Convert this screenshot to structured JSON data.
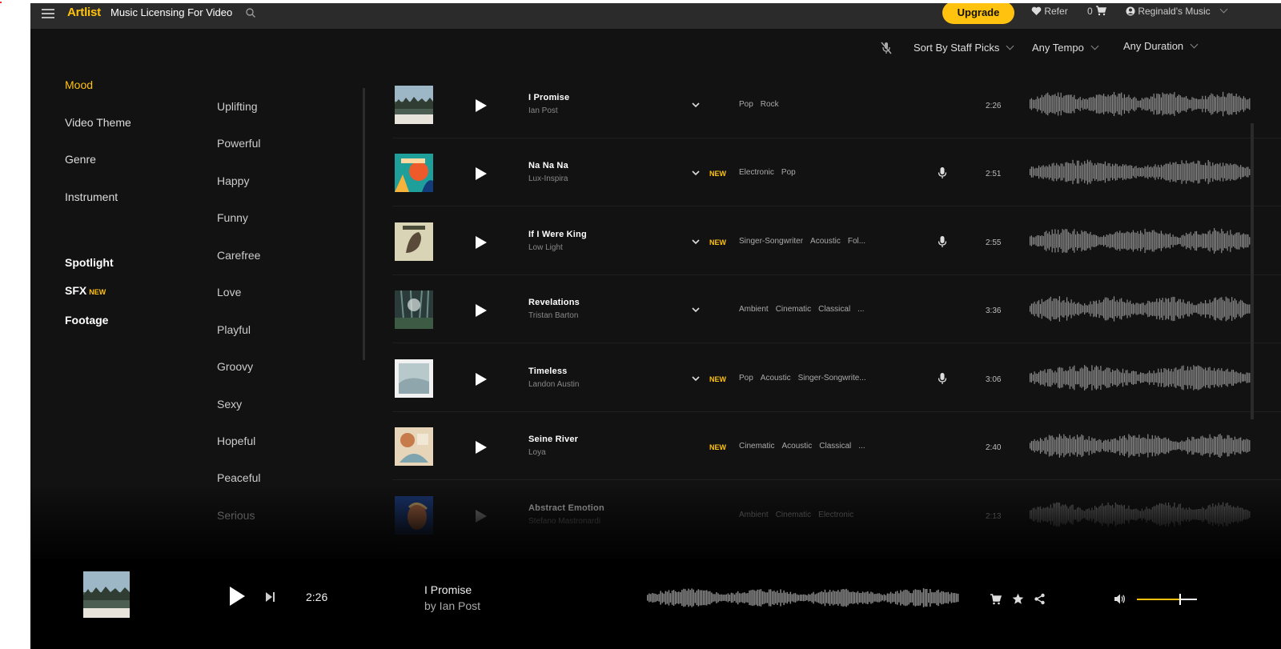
{
  "header": {
    "brand": "Artlist",
    "subtitle": "Music Licensing For Video",
    "upgrade": "Upgrade",
    "refer": "Refer",
    "cart_count": "0",
    "account": "Reginald's Music"
  },
  "filters": {
    "sort": "Sort By Staff Picks",
    "tempo": "Any Tempo",
    "duration": "Any Duration"
  },
  "nav": {
    "categories": [
      "Mood",
      "Video Theme",
      "Genre",
      "Instrument"
    ],
    "extras": [
      "Spotlight",
      "SFX",
      "Footage"
    ],
    "sfx_badge": "NEW",
    "moods": [
      "Uplifting",
      "Powerful",
      "Happy",
      "Funny",
      "Carefree",
      "Love",
      "Playful",
      "Groovy",
      "Sexy",
      "Hopeful",
      "Peaceful",
      "Serious"
    ]
  },
  "tracks": [
    {
      "title": "I Promise",
      "artist": "Ian Post",
      "new": "",
      "tags": [
        "Pop",
        "Rock"
      ],
      "vocal": false,
      "duration": "2:26"
    },
    {
      "title": "Na Na Na",
      "artist": "Lux-Inspira",
      "new": "NEW",
      "tags": [
        "Electronic",
        "Pop"
      ],
      "vocal": true,
      "duration": "2:51"
    },
    {
      "title": "If I Were King",
      "artist": "Low Light",
      "new": "NEW",
      "tags": [
        "Singer-Songwriter",
        "Acoustic",
        "Fol..."
      ],
      "vocal": true,
      "duration": "2:55"
    },
    {
      "title": "Revelations",
      "artist": "Tristan Barton",
      "new": "",
      "tags": [
        "Ambient",
        "Cinematic",
        "Classical",
        "..."
      ],
      "vocal": false,
      "duration": "3:36"
    },
    {
      "title": "Timeless",
      "artist": "Landon Austin",
      "new": "NEW",
      "tags": [
        "Pop",
        "Acoustic",
        "Singer-Songwrite..."
      ],
      "vocal": true,
      "duration": "3:06"
    },
    {
      "title": "Seine River",
      "artist": "Loya",
      "new": "NEW",
      "tags": [
        "Cinematic",
        "Acoustic",
        "Classical",
        "..."
      ],
      "vocal": false,
      "duration": "2:40"
    },
    {
      "title": "Abstract Emotion",
      "artist": "Stefano Mastronardi",
      "new": "",
      "tags": [
        "Ambient",
        "Cinematic",
        "Electronic"
      ],
      "vocal": false,
      "duration": "2:13"
    }
  ],
  "player": {
    "time": "2:26",
    "title": "I Promise",
    "by": "by Ian Post",
    "volume": 0.7
  },
  "colors": {
    "accent": "#ffc20e",
    "background": "#121212",
    "header": "#2b2b2b",
    "player": "#000000"
  }
}
